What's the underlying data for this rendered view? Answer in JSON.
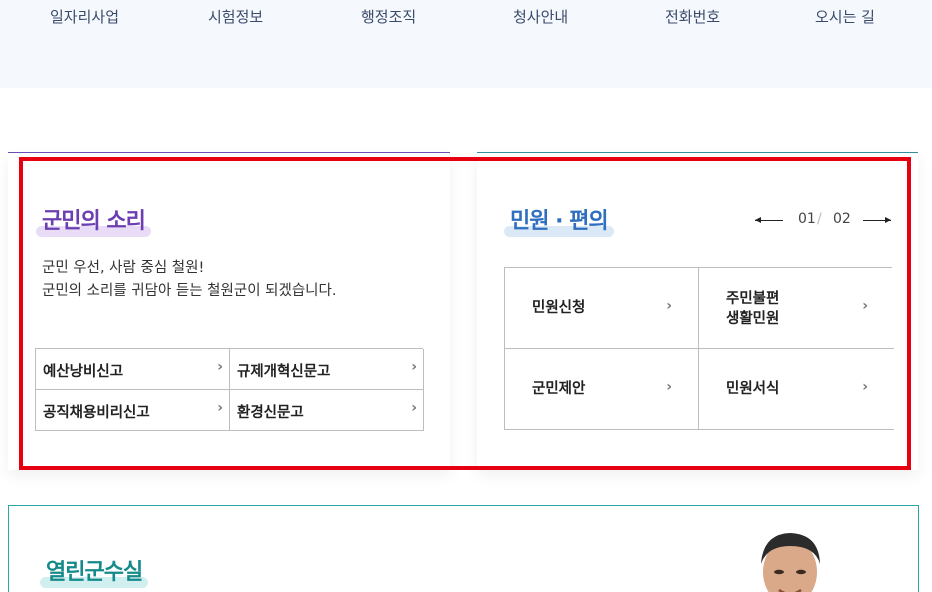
{
  "topnav": {
    "items": [
      "일자리사업",
      "시험정보",
      "행정조직",
      "청사안내",
      "전화번호",
      "오시는 길"
    ]
  },
  "voice": {
    "title": "군민의 소리",
    "desc_line1": "군민 우선, 사람 중심 철원!",
    "desc_line2": "군민의 소리를 귀담아 듣는 철원군이 되겠습니다.",
    "links": [
      "예산낭비신고",
      "규제개혁신문고",
      "공직채용비리신고",
      "환경신문고"
    ]
  },
  "minwon": {
    "title": "민원 · 편의",
    "pager": {
      "current": "01",
      "separator": "/",
      "total": "02"
    },
    "links": [
      {
        "line1": "민원신청",
        "line2": ""
      },
      {
        "line1": "주민불편",
        "line2": "생활민원"
      },
      {
        "line1": "군민제안",
        "line2": ""
      },
      {
        "line1": "민원서식",
        "line2": ""
      }
    ]
  },
  "open_office": {
    "title": "열린군수실"
  },
  "icons": {
    "chevron": "chevron-right-icon",
    "prev": "arrow-left-icon",
    "next": "arrow-right-icon"
  },
  "colors": {
    "voice_accent": "#6b3fb2",
    "minwon_accent": "#2f6fc0",
    "open_accent": "#158a8a",
    "highlight_frame": "#e60012"
  }
}
